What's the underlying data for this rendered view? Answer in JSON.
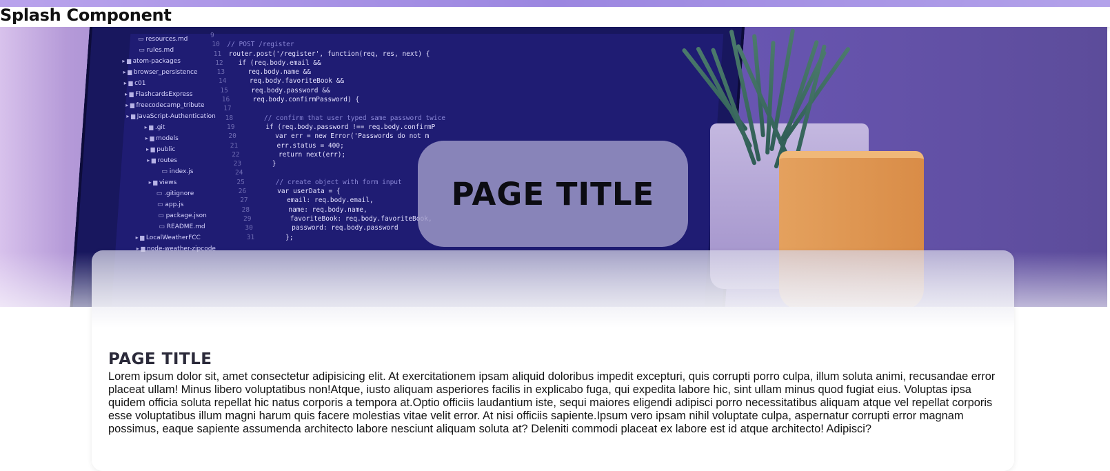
{
  "header": {
    "title": "Splash Component",
    "accent_color": "#9b86e0"
  },
  "hero": {
    "title": "PAGE TITLE",
    "background_image": "laptop-code-editor-photo",
    "file_tree": [
      "resources.md",
      "rules.md",
      "atom-packages",
      "browser_persistence",
      "c01",
      "FlashcardsExpress",
      "freecodecamp_tribute",
      "JavaScript-Authentication",
      ".git",
      "models",
      "public",
      "routes",
      "index.js",
      "views",
      ".gitignore",
      "app.js",
      "package.json",
      "README.md",
      "LocalWeatherFCC",
      "node-weather-zipcode"
    ],
    "code_lines": [
      {
        "n": "9",
        "t": ""
      },
      {
        "n": "10",
        "t": "// POST /register"
      },
      {
        "n": "11",
        "t": "router.post('/register', function(req, res, next) {"
      },
      {
        "n": "12",
        "t": "  if (req.body.email &&"
      },
      {
        "n": "13",
        "t": "    req.body.name &&"
      },
      {
        "n": "14",
        "t": "    req.body.favoriteBook &&"
      },
      {
        "n": "15",
        "t": "    req.body.password &&"
      },
      {
        "n": "16",
        "t": "    req.body.confirmPassword) {"
      },
      {
        "n": "17",
        "t": ""
      },
      {
        "n": "18",
        "t": "      // confirm that user typed same password twice"
      },
      {
        "n": "19",
        "t": "      if (req.body.password !== req.body.confirmP"
      },
      {
        "n": "20",
        "t": "        var err = new Error('Passwords do not m"
      },
      {
        "n": "21",
        "t": "        err.status = 400;"
      },
      {
        "n": "22",
        "t": "        return next(err);"
      },
      {
        "n": "23",
        "t": "      }"
      },
      {
        "n": "24",
        "t": ""
      },
      {
        "n": "25",
        "t": "      // create object with form input"
      },
      {
        "n": "26",
        "t": "      var userData = {"
      },
      {
        "n": "27",
        "t": "        email: req.body.email,"
      },
      {
        "n": "28",
        "t": "        name: req.body.name,"
      },
      {
        "n": "29",
        "t": "        favoriteBook: req.body.favoriteBook,"
      },
      {
        "n": "30",
        "t": "        password: req.body.password"
      },
      {
        "n": "31",
        "t": "      };"
      }
    ]
  },
  "card": {
    "heading": "PAGE TITLE",
    "body": "Lorem ipsum dolor sit, amet consectetur adipisicing elit. At exercitationem ipsam aliquid doloribus impedit excepturi, quis corrupti porro culpa, illum soluta animi, recusandae error placeat ullam! Minus libero voluptatibus non!Atque, iusto aliquam asperiores facilis in explicabo fuga, qui expedita labore hic, sint ullam minus quod fugiat eius. Voluptas ipsa quidem officia soluta repellat hic natus corporis a tempora at.Optio officiis laudantium iste, sequi maiores eligendi adipisci porro necessitatibus aliquam atque vel repellat corporis esse voluptatibus illum magni harum quis facere molestias vitae velit error. At nisi officiis sapiente.Ipsum vero ipsam nihil voluptate culpa, aspernatur corrupti error magnam possimus, eaque sapiente assumenda architecto labore nesciunt aliquam soluta at? Deleniti commodi placeat ex labore est id atque architecto! Adipisci?"
  }
}
